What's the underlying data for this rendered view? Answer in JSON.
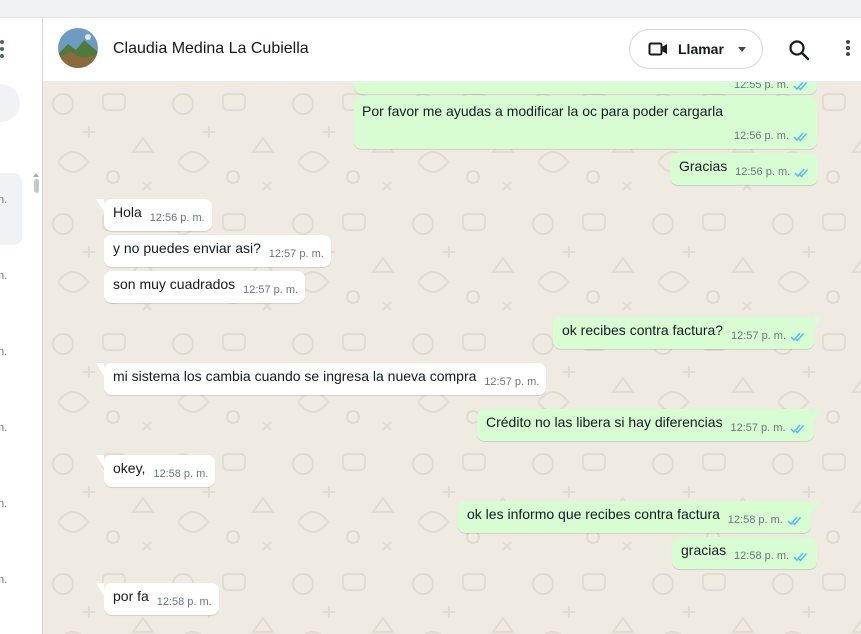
{
  "header": {
    "contact_name": "Claudia Medina La Cubiella",
    "call_label": "Llamar"
  },
  "sidebar": {
    "time_fragments": [
      "n.",
      "n.",
      "n.",
      "n.",
      "n.",
      "n."
    ]
  },
  "messages": [
    {
      "dir": "out",
      "text": "",
      "time": "12:55 p. m.",
      "read": true
    },
    {
      "dir": "out",
      "text": "Por favor me ayudas a modificar la oc para poder cargarla",
      "time": "12:56 p. m.",
      "read": true
    },
    {
      "dir": "out",
      "text": "Gracias",
      "time": "12:56 p. m.",
      "read": true
    },
    {
      "dir": "in",
      "text": "Hola",
      "time": "12:56 p. m."
    },
    {
      "dir": "in",
      "text": "y no puedes enviar asi?",
      "time": "12:57 p. m."
    },
    {
      "dir": "in",
      "text": "son muy cuadrados",
      "time": "12:57 p. m."
    },
    {
      "dir": "out",
      "text": "ok recibes contra factura?",
      "time": "12:57 p. m.",
      "read": true
    },
    {
      "dir": "in",
      "text": "mi sistema los cambia cuando se ingresa la nueva compra",
      "time": "12:57 p. m."
    },
    {
      "dir": "out",
      "text": "Crédito no las libera si hay diferencias",
      "time": "12:57 p. m.",
      "read": true
    },
    {
      "dir": "in",
      "text": "okey,",
      "time": "12:58 p. m."
    },
    {
      "dir": "out",
      "text": "ok les informo que recibes contra factura",
      "time": "12:58 p. m.",
      "read": true
    },
    {
      "dir": "out",
      "text": "gracias",
      "time": "12:58 p. m.",
      "read": true
    },
    {
      "dir": "in",
      "text": "por fa",
      "time": "12:58 p. m."
    }
  ],
  "colors": {
    "chat_background": "#efeae2",
    "incoming_bubble": "#ffffff",
    "outgoing_bubble": "#d9fdd3",
    "read_ticks": "#53bdeb"
  },
  "icons": [
    "video-call-icon",
    "chevron-down-icon",
    "search-icon",
    "menu-dots-icon",
    "double-check-icon"
  ]
}
